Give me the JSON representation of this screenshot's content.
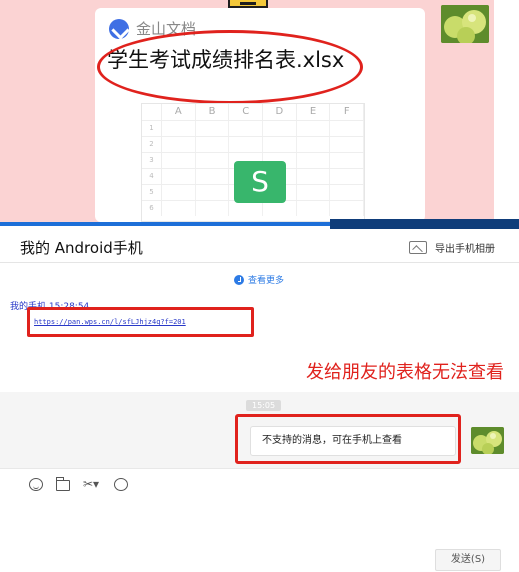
{
  "mobile_card": {
    "source_app": "金山文档",
    "file_name": "学生考试成绩排名表.xlsx",
    "sheet_columns": [
      "",
      "A",
      "B",
      "C",
      "D",
      "E",
      "F"
    ],
    "sheet_rows": [
      "1",
      "2",
      "3",
      "4",
      "5",
      "6"
    ],
    "wps_badge": "S",
    "icons": {
      "app_logo": "kdocs-logo-icon",
      "sheet_logo": "wps-sheet-icon",
      "avatar": "apple-avatar"
    }
  },
  "chat": {
    "title": "我的 Android手机",
    "export_label": "导出手机相册",
    "view_more": "查看更多",
    "sender_line": "我的手机  15:28:54",
    "link_text": "https://pan.wps.cn/l/sfLJhjz4q?f=201",
    "annotation": "发给朋友的表格无法查看",
    "timestamp": "15:05",
    "message": "不支持的消息，可在手机上查看",
    "toolbar": [
      "emoji-icon",
      "folder-icon",
      "scissors-icon",
      "chat-icon"
    ],
    "send_label": "发送(S)"
  },
  "colors": {
    "pink_bg": "#fbd3d3",
    "highlight_red": "#e0221d",
    "link_blue": "#2838c8",
    "wps_green": "#38b66c"
  }
}
